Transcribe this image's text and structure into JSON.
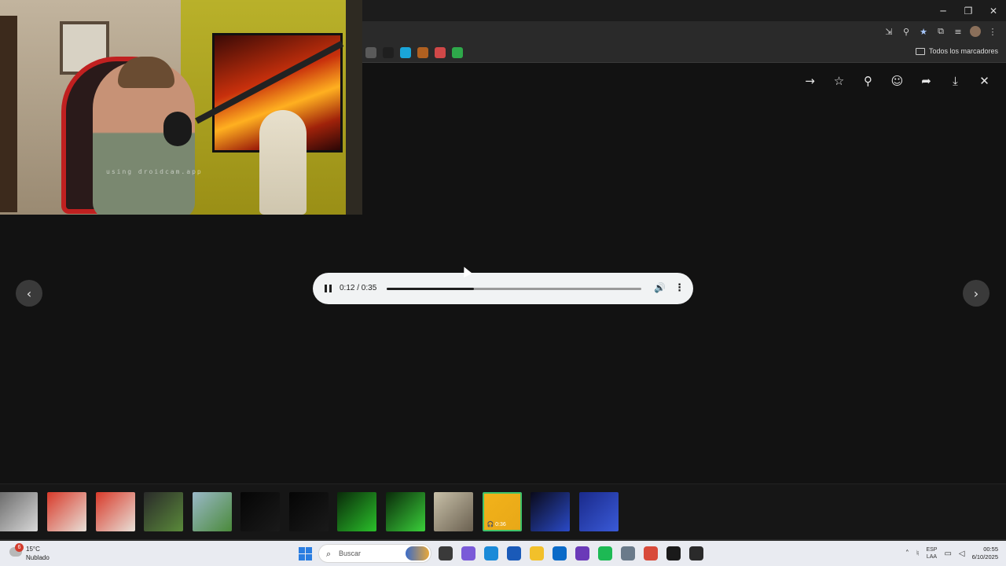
{
  "window": {
    "controls": {
      "minimize": "─",
      "restore": "❐",
      "close": "✕"
    }
  },
  "browser": {
    "toolbar_icons": [
      "install-icon",
      "zoom-icon",
      "star-icon",
      "extensions-icon",
      "media-icon",
      "profile-avatar",
      "menu-icon"
    ],
    "bookmarks": [
      {
        "name": "bookmark-1",
        "color": "#5a5a5a"
      },
      {
        "name": "bookmark-2",
        "color": "#1f1f1f"
      },
      {
        "name": "bookmark-3",
        "color": "#1aa5d9"
      },
      {
        "name": "bookmark-4",
        "color": "#b06020"
      },
      {
        "name": "bookmark-5",
        "color": "#d04848"
      },
      {
        "name": "bookmark-6",
        "color": "#2ea84a"
      }
    ],
    "all_bookmarks_label": "Todos los marcadores"
  },
  "viewer": {
    "actions": [
      {
        "name": "forward-icon",
        "glyph": "→"
      },
      {
        "name": "star-outline-icon",
        "glyph": "☆"
      },
      {
        "name": "pin-icon",
        "glyph": "⚲"
      },
      {
        "name": "emoji-icon",
        "glyph": "☺"
      },
      {
        "name": "share-icon",
        "glyph": "➦"
      },
      {
        "name": "download-icon",
        "glyph": "⤓"
      },
      {
        "name": "close-icon",
        "glyph": "✕"
      }
    ],
    "prev_glyph": "‹",
    "next_glyph": "›"
  },
  "webcam": {
    "watermark": "using droidcam.app"
  },
  "player": {
    "time": "0:12 / 0:35",
    "progress": 0.343,
    "volume_glyph": "🔊",
    "more_glyph": "⋮"
  },
  "thumbnails": [
    {
      "name": "thumb-1",
      "colors": [
        "#6a6a6a",
        "#d8d8d8"
      ]
    },
    {
      "name": "thumb-2",
      "colors": [
        "#d83a2a",
        "#e8e0d8"
      ]
    },
    {
      "name": "thumb-3",
      "colors": [
        "#d83a2a",
        "#e8e0d8"
      ]
    },
    {
      "name": "thumb-4",
      "colors": [
        "#2a2a2a",
        "#5a8a3a"
      ]
    },
    {
      "name": "thumb-5",
      "colors": [
        "#9ab8c8",
        "#4a8a3a"
      ]
    },
    {
      "name": "thumb-6",
      "colors": [
        "#050505",
        "#1a1a1a"
      ]
    },
    {
      "name": "thumb-7",
      "colors": [
        "#050505",
        "#1a1a1a"
      ]
    },
    {
      "name": "thumb-8",
      "colors": [
        "#0a2a0a",
        "#2ac02a"
      ]
    },
    {
      "name": "thumb-9",
      "colors": [
        "#0a2a0a",
        "#3ad03a"
      ]
    },
    {
      "name": "thumb-10",
      "colors": [
        "#c8c0a8",
        "#6a6050"
      ]
    },
    {
      "name": "thumb-11",
      "colors": [
        "#f2b21a",
        "#e8a818"
      ],
      "duration": "0:36",
      "active": true
    },
    {
      "name": "thumb-12",
      "colors": [
        "#0a0a1a",
        "#2a4ac8"
      ]
    },
    {
      "name": "thumb-13",
      "colors": [
        "#1a2a8a",
        "#3a5ad8"
      ]
    }
  ],
  "taskbar": {
    "notification_count": "6",
    "weather_temp": "15°C",
    "weather_desc": "Nublado",
    "search_placeholder": "Buscar",
    "apps": [
      {
        "name": "file-manager-icon",
        "color": "#3a3a3a"
      },
      {
        "name": "copilot-icon",
        "color": "#7a5ad8"
      },
      {
        "name": "edge-icon",
        "color": "#1a8ad8"
      },
      {
        "name": "store-icon",
        "color": "#1a5ab8"
      },
      {
        "name": "folder-icon",
        "color": "#f2c02a"
      },
      {
        "name": "outlook-icon",
        "color": "#0a6ac8"
      },
      {
        "name": "clapper-icon",
        "color": "#6a3ab8"
      },
      {
        "name": "spotify-icon",
        "color": "#1db954"
      },
      {
        "name": "settings-icon",
        "color": "#6a7a8a"
      },
      {
        "name": "chrome-icon",
        "color": "#d84a3a"
      },
      {
        "name": "app-icon-black",
        "color": "#1a1a1a"
      },
      {
        "name": "app-icon-notify",
        "color": "#2a2a2a"
      }
    ],
    "lang_line1": "ESP",
    "lang_line2": "LAA",
    "time": "00:55",
    "date": "6/10/2025"
  }
}
